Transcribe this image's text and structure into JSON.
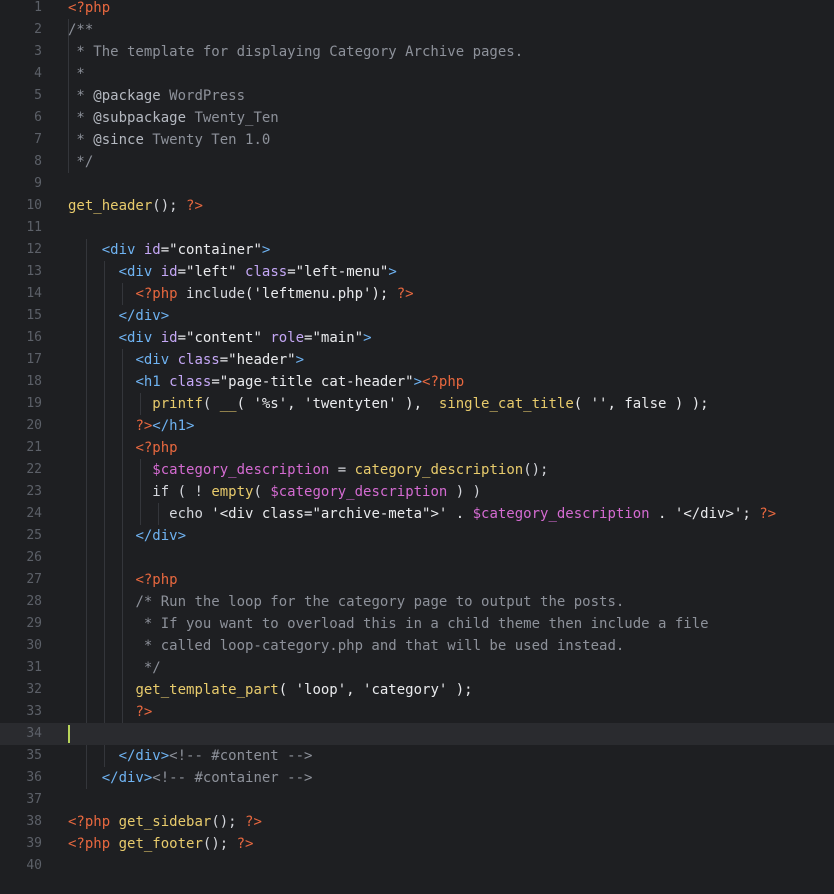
{
  "editor": {
    "language": "php",
    "current_line": 34,
    "colors": {
      "background": "#1e1f22",
      "current_line_bg": "#2a2b2f",
      "line_number": "#5c6068",
      "php_tag": "#e8683f",
      "comment": "#8d919a",
      "function": "#e8cb6c",
      "html_tag": "#6fb3f2",
      "attribute": "#c4a7f5",
      "variable": "#d46bd1",
      "caret": "#b8d45a"
    },
    "lines": [
      {
        "n": "1",
        "tokens": [
          {
            "t": "<?php",
            "c": "php"
          }
        ]
      },
      {
        "n": "2",
        "tokens": [
          {
            "t": "/**",
            "c": "cm"
          }
        ]
      },
      {
        "n": "3",
        "tokens": [
          {
            "t": " * The template for displaying Category Archive pages.",
            "c": "cm"
          }
        ]
      },
      {
        "n": "4",
        "tokens": [
          {
            "t": " *",
            "c": "cm"
          }
        ]
      },
      {
        "n": "5",
        "tokens": [
          {
            "t": " * ",
            "c": "cm"
          },
          {
            "t": "@package",
            "c": "doc"
          },
          {
            "t": " WordPress",
            "c": "cm"
          }
        ]
      },
      {
        "n": "6",
        "tokens": [
          {
            "t": " * ",
            "c": "cm"
          },
          {
            "t": "@subpackage",
            "c": "doc"
          },
          {
            "t": " Twenty_Ten",
            "c": "cm"
          }
        ]
      },
      {
        "n": "7",
        "tokens": [
          {
            "t": " * ",
            "c": "cm"
          },
          {
            "t": "@since",
            "c": "doc"
          },
          {
            "t": " Twenty Ten 1.0",
            "c": "cm"
          }
        ]
      },
      {
        "n": "8",
        "tokens": [
          {
            "t": " */",
            "c": "cm"
          }
        ]
      },
      {
        "n": "9",
        "tokens": []
      },
      {
        "n": "10",
        "tokens": [
          {
            "t": "get_header",
            "c": "fn"
          },
          {
            "t": "(); ",
            "c": "txt"
          },
          {
            "t": "?>",
            "c": "php"
          }
        ]
      },
      {
        "n": "11",
        "tokens": []
      },
      {
        "n": "12",
        "tokens": [
          {
            "t": "    ",
            "c": "txt"
          },
          {
            "t": "<div",
            "c": "tag"
          },
          {
            "t": " id",
            "c": "att"
          },
          {
            "t": "=\"container\"",
            "c": "str"
          },
          {
            "t": ">",
            "c": "tag"
          }
        ]
      },
      {
        "n": "13",
        "tokens": [
          {
            "t": "      ",
            "c": "txt"
          },
          {
            "t": "<div",
            "c": "tag"
          },
          {
            "t": " id",
            "c": "att"
          },
          {
            "t": "=\"left\"",
            "c": "str"
          },
          {
            "t": " class",
            "c": "att"
          },
          {
            "t": "=\"left-menu\"",
            "c": "str"
          },
          {
            "t": ">",
            "c": "tag"
          }
        ]
      },
      {
        "n": "14",
        "tokens": [
          {
            "t": "        ",
            "c": "txt"
          },
          {
            "t": "<?php",
            "c": "php"
          },
          {
            "t": " include",
            "c": "txt"
          },
          {
            "t": "('leftmenu.php'); ",
            "c": "str"
          },
          {
            "t": "?>",
            "c": "php"
          }
        ]
      },
      {
        "n": "15",
        "tokens": [
          {
            "t": "      ",
            "c": "txt"
          },
          {
            "t": "</div>",
            "c": "tag"
          }
        ]
      },
      {
        "n": "16",
        "tokens": [
          {
            "t": "      ",
            "c": "txt"
          },
          {
            "t": "<div",
            "c": "tag"
          },
          {
            "t": " id",
            "c": "att"
          },
          {
            "t": "=\"content\"",
            "c": "str"
          },
          {
            "t": " role",
            "c": "att"
          },
          {
            "t": "=\"main\"",
            "c": "str"
          },
          {
            "t": ">",
            "c": "tag"
          }
        ]
      },
      {
        "n": "17",
        "tokens": [
          {
            "t": "        ",
            "c": "txt"
          },
          {
            "t": "<div",
            "c": "tag"
          },
          {
            "t": " class",
            "c": "att"
          },
          {
            "t": "=\"header\"",
            "c": "str"
          },
          {
            "t": ">",
            "c": "tag"
          }
        ]
      },
      {
        "n": "18",
        "tokens": [
          {
            "t": "        ",
            "c": "txt"
          },
          {
            "t": "<h1",
            "c": "tag"
          },
          {
            "t": " class",
            "c": "att"
          },
          {
            "t": "=\"page-title cat-header\"",
            "c": "str"
          },
          {
            "t": ">",
            "c": "tag"
          },
          {
            "t": "<?php",
            "c": "php"
          }
        ]
      },
      {
        "n": "19",
        "tokens": [
          {
            "t": "          ",
            "c": "txt"
          },
          {
            "t": "printf",
            "c": "fn"
          },
          {
            "t": "( ",
            "c": "txt"
          },
          {
            "t": "__",
            "c": "fn"
          },
          {
            "t": "( '%s', 'twentyten' ),  ",
            "c": "str"
          },
          {
            "t": "single_cat_title",
            "c": "fn"
          },
          {
            "t": "( '', false ) );",
            "c": "str"
          }
        ]
      },
      {
        "n": "20",
        "tokens": [
          {
            "t": "        ",
            "c": "txt"
          },
          {
            "t": "?>",
            "c": "php"
          },
          {
            "t": "</h1>",
            "c": "tag"
          }
        ]
      },
      {
        "n": "21",
        "tokens": [
          {
            "t": "        ",
            "c": "txt"
          },
          {
            "t": "<?php",
            "c": "php"
          }
        ]
      },
      {
        "n": "22",
        "tokens": [
          {
            "t": "          ",
            "c": "txt"
          },
          {
            "t": "$category_description",
            "c": "var"
          },
          {
            "t": " = ",
            "c": "txt"
          },
          {
            "t": "category_description",
            "c": "fn"
          },
          {
            "t": "();",
            "c": "txt"
          }
        ]
      },
      {
        "n": "23",
        "tokens": [
          {
            "t": "          ",
            "c": "txt"
          },
          {
            "t": "if ( ! ",
            "c": "kw"
          },
          {
            "t": "empty",
            "c": "fn"
          },
          {
            "t": "( ",
            "c": "txt"
          },
          {
            "t": "$category_description",
            "c": "var"
          },
          {
            "t": " ) )",
            "c": "txt"
          }
        ]
      },
      {
        "n": "24",
        "tokens": [
          {
            "t": "            ",
            "c": "txt"
          },
          {
            "t": "echo",
            "c": "kw"
          },
          {
            "t": " '<div class=\"archive-meta\">' . ",
            "c": "str"
          },
          {
            "t": "$category_description",
            "c": "var"
          },
          {
            "t": " . '</div>'; ",
            "c": "str"
          },
          {
            "t": "?>",
            "c": "php"
          }
        ]
      },
      {
        "n": "25",
        "tokens": [
          {
            "t": "        ",
            "c": "txt"
          },
          {
            "t": "</div>",
            "c": "tag"
          }
        ]
      },
      {
        "n": "26",
        "tokens": []
      },
      {
        "n": "27",
        "tokens": [
          {
            "t": "        ",
            "c": "txt"
          },
          {
            "t": "<?php",
            "c": "php"
          }
        ]
      },
      {
        "n": "28",
        "tokens": [
          {
            "t": "        ",
            "c": "txt"
          },
          {
            "t": "/* Run the loop for the category page to output the posts.",
            "c": "cm"
          }
        ]
      },
      {
        "n": "29",
        "tokens": [
          {
            "t": "         ",
            "c": "txt"
          },
          {
            "t": "* If you want to overload this in a child theme then include a file",
            "c": "cm"
          }
        ]
      },
      {
        "n": "30",
        "tokens": [
          {
            "t": "         ",
            "c": "txt"
          },
          {
            "t": "* called loop-category.php and that will be used instead.",
            "c": "cm"
          }
        ]
      },
      {
        "n": "31",
        "tokens": [
          {
            "t": "         ",
            "c": "txt"
          },
          {
            "t": "*/",
            "c": "cm"
          }
        ]
      },
      {
        "n": "32",
        "tokens": [
          {
            "t": "        ",
            "c": "txt"
          },
          {
            "t": "get_template_part",
            "c": "fn"
          },
          {
            "t": "( 'loop', 'category' );",
            "c": "str"
          }
        ]
      },
      {
        "n": "33",
        "tokens": [
          {
            "t": "        ",
            "c": "txt"
          },
          {
            "t": "?>",
            "c": "php"
          }
        ]
      },
      {
        "n": "34",
        "tokens": []
      },
      {
        "n": "35",
        "tokens": [
          {
            "t": "      ",
            "c": "txt"
          },
          {
            "t": "</div>",
            "c": "tag"
          },
          {
            "t": "<!-- #content -->",
            "c": "cm"
          }
        ]
      },
      {
        "n": "36",
        "tokens": [
          {
            "t": "    ",
            "c": "txt"
          },
          {
            "t": "</div>",
            "c": "tag"
          },
          {
            "t": "<!-- #container -->",
            "c": "cm"
          }
        ]
      },
      {
        "n": "37",
        "tokens": []
      },
      {
        "n": "38",
        "tokens": [
          {
            "t": "<?php",
            "c": "php"
          },
          {
            "t": " ",
            "c": "txt"
          },
          {
            "t": "get_sidebar",
            "c": "fn"
          },
          {
            "t": "(); ",
            "c": "txt"
          },
          {
            "t": "?>",
            "c": "php"
          }
        ]
      },
      {
        "n": "39",
        "tokens": [
          {
            "t": "<?php",
            "c": "php"
          },
          {
            "t": " ",
            "c": "txt"
          },
          {
            "t": "get_footer",
            "c": "fn"
          },
          {
            "t": "(); ",
            "c": "txt"
          },
          {
            "t": "?>",
            "c": "php"
          }
        ]
      },
      {
        "n": "40",
        "tokens": []
      }
    ]
  }
}
